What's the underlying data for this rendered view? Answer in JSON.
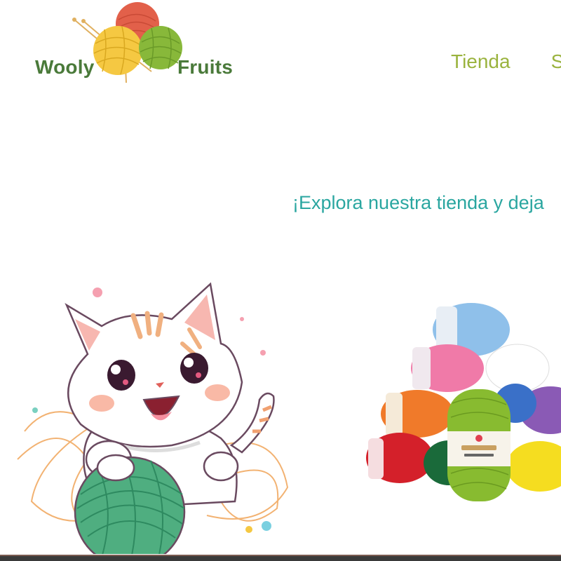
{
  "brand": {
    "word_left": "Wooly",
    "word_right": "Fruits",
    "color": "#4a7a3a"
  },
  "nav": {
    "items": [
      {
        "label": "Tienda"
      },
      {
        "label": "S"
      }
    ],
    "color": "#9ab33e"
  },
  "hero": {
    "tagline": "¡Explora nuestra tienda y deja",
    "tagline_color": "#2aa6a0"
  },
  "images": {
    "cat_icon": "cat-with-yarn-ball-icon",
    "yarn_icon": "yarn-skeins-stack-icon"
  }
}
